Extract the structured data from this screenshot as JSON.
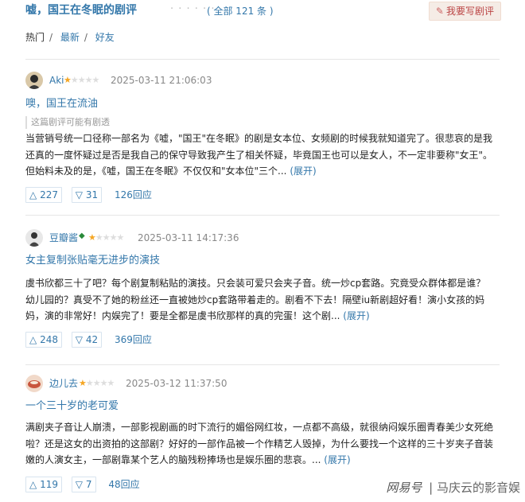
{
  "header": {
    "title": "嘘，国王在冬眠的剧评",
    "dots": "· · · · · ·",
    "count": "( 全部 121 条 )",
    "write_button": "我要写剧评"
  },
  "sort": {
    "hot": "热门",
    "newest": "最新",
    "friends": "好友",
    "sep": "/"
  },
  "reviews": [
    {
      "username": "Aki",
      "rating": 1,
      "date": "2025-03-11 21:06:03",
      "headline": "噢，国王在流油",
      "spoiler": "这篇剧评可能有剧透",
      "body": "当营销号统一口径称一部名为《嘘，\"国王\"在冬眠》的剧是女本位、女频剧的时候我就知道完了。很悲哀的是我还真的一度怀疑过是否是我自己的保守导致我产生了相关怀疑，毕竟国王也可以是女人，不一定非要称\"女王\"。但始料未及的是，《嘘，国王在冬眠》不仅仅和\"女本位\"三个...",
      "expand": "(展开)",
      "up": "227",
      "down": "31",
      "replies": "126回应"
    },
    {
      "username": "豆瓣酱",
      "rating": 1,
      "date": "2025-03-11 14:17:36",
      "headline": "女主复制张贴毫无进步的演技",
      "body": "虞书欣都三十了吧？每个剧复制粘贴的演技。只会装可爱只会夹子音。统一炒cp套路。究竟受众群体都是谁？幼儿园的？真受不了她的粉丝还一直被她炒cp套路带着走的。剧看不下去！隔壁iu新剧超好看！演小女孩的妈妈，演的非常好！内娱完了！要是全都是虞书欣那样的真的完蛋！这个剧...",
      "expand": "(展开)",
      "up": "248",
      "down": "42",
      "replies": "369回应"
    },
    {
      "username": "边儿去",
      "rating": 1,
      "date": "2025-03-12 11:37:50",
      "headline": "一个三十岁的老可爱",
      "body": "满剧夹子音让人崩溃，一部影视剧画的时下流行的媚俗网红妆，一点都不高级，就很纳闷娱乐圈青春美少女死绝啦？还是这女的出资拍的这部剧？好好的一部作品被一个作精艺人毁掉，为什么要找一个这样的三十岁夹子音装嫩的人演女主，一部剧靠某个艺人的脑残粉捧场也是娱乐圈的悲哀。...",
      "expand": "(展开)",
      "up": "119",
      "down": "7",
      "replies": "48回应"
    }
  ],
  "watermark": {
    "brand": "网易号",
    "sep": "|",
    "name": "马庆云的影音娱"
  },
  "colors": {
    "link": "#3377aa",
    "star": "#f5a623",
    "write_bg": "#f5ece6"
  }
}
